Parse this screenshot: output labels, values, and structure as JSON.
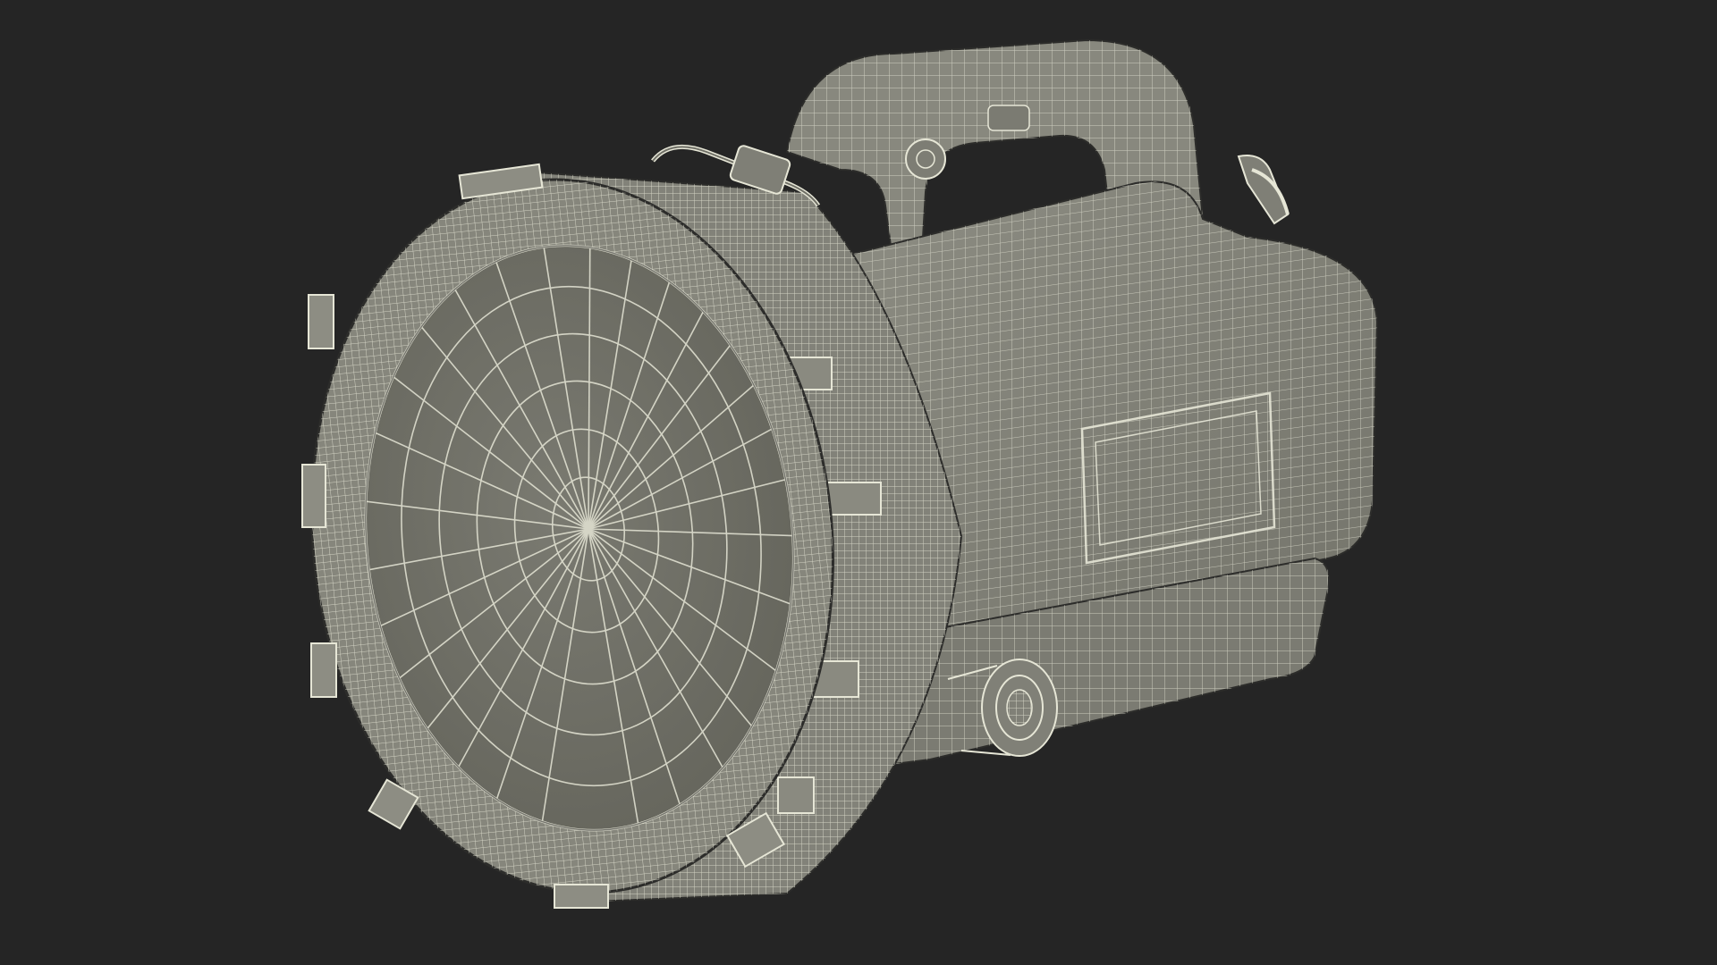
{
  "scene": {
    "subject": "wireframe-searchlight-render",
    "colors": {
      "background": "#252525",
      "surface": "#7d7d74",
      "surface_light": "#8a8a80",
      "surface_dark": "#5f5f58",
      "lens": "#6f6f66",
      "wire": "#e6e6d6"
    }
  }
}
